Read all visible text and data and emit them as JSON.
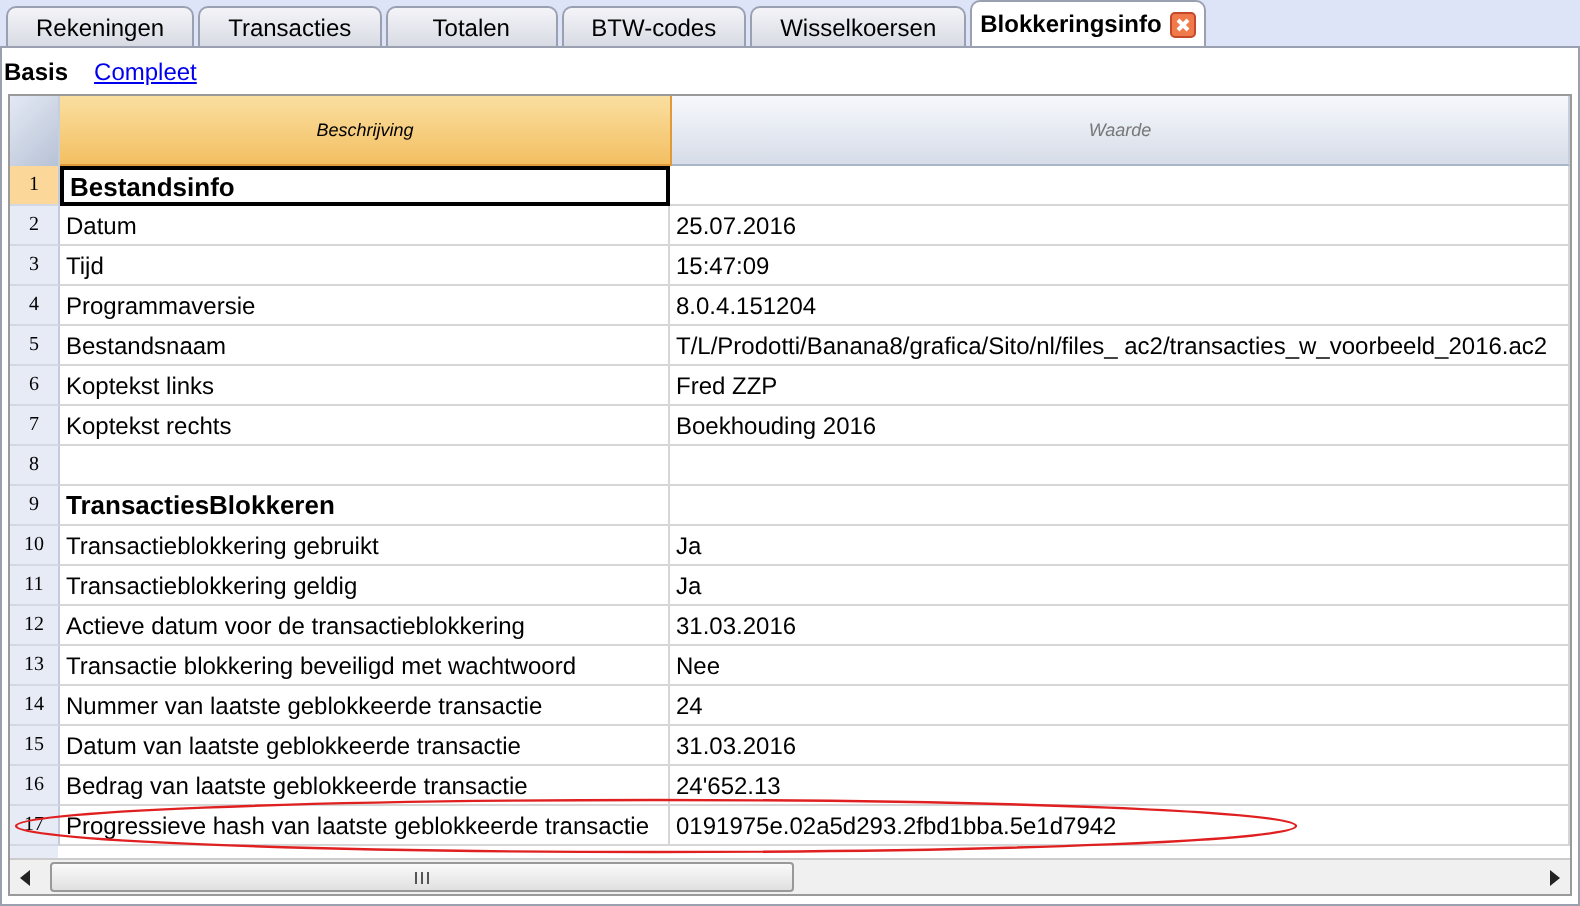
{
  "tabs": [
    {
      "label": "Rekeningen",
      "selected": false,
      "closable": false
    },
    {
      "label": "Transacties",
      "selected": false,
      "closable": false
    },
    {
      "label": "Totalen",
      "selected": false,
      "closable": false
    },
    {
      "label": "BTW-codes",
      "selected": false,
      "closable": false
    },
    {
      "label": "Wisselkoersen",
      "selected": false,
      "closable": false
    },
    {
      "label": "Blokkeringsinfo",
      "selected": true,
      "closable": true
    }
  ],
  "views": [
    {
      "label": "Basis",
      "selected": true
    },
    {
      "label": "Compleet",
      "selected": false
    }
  ],
  "table": {
    "columns": [
      {
        "label": "Beschrijving",
        "selected": true
      },
      {
        "label": "Waarde",
        "selected": false
      }
    ],
    "rows": [
      {
        "number": "1",
        "kind": "section",
        "description": "Bestandsinfo",
        "value": "",
        "selected": true,
        "circled": false
      },
      {
        "number": "2",
        "kind": "item",
        "description": "Datum",
        "value": "25.07.2016",
        "selected": false,
        "circled": false
      },
      {
        "number": "3",
        "kind": "item",
        "description": "Tijd",
        "value": "15:47:09",
        "selected": false,
        "circled": false
      },
      {
        "number": "4",
        "kind": "item",
        "description": "Programmaversie",
        "value": "8.0.4.151204",
        "selected": false,
        "circled": false
      },
      {
        "number": "5",
        "kind": "item",
        "description": "Bestandsnaam",
        "value": "T/L/Prodotti/Banana8/grafica/Sito/nl/files_ ac2/transacties_w_voorbeeld_2016.ac2",
        "selected": false,
        "circled": false
      },
      {
        "number": "6",
        "kind": "item",
        "description": "Koptekst links",
        "value": "Fred ZZP",
        "selected": false,
        "circled": false
      },
      {
        "number": "7",
        "kind": "item",
        "description": "Koptekst rechts",
        "value": "Boekhouding 2016",
        "selected": false,
        "circled": false
      },
      {
        "number": "8",
        "kind": "item",
        "description": "",
        "value": "",
        "selected": false,
        "circled": false
      },
      {
        "number": "9",
        "kind": "section",
        "description": "TransactiesBlokkeren",
        "value": "",
        "selected": false,
        "circled": false
      },
      {
        "number": "10",
        "kind": "item",
        "description": "Transactieblokkering gebruikt",
        "value": "Ja",
        "selected": false,
        "circled": false
      },
      {
        "number": "11",
        "kind": "item",
        "description": "Transactieblokkering geldig",
        "value": "Ja",
        "selected": false,
        "circled": false
      },
      {
        "number": "12",
        "kind": "item",
        "description": "Actieve datum voor de transactieblokkering",
        "value": "31.03.2016",
        "selected": false,
        "circled": false
      },
      {
        "number": "13",
        "kind": "item",
        "description": "Transactie blokkering beveiligd met wachtwoord",
        "value": "Nee",
        "selected": false,
        "circled": false
      },
      {
        "number": "14",
        "kind": "item",
        "description": "Nummer van laatste geblokkeerde transactie",
        "value": "24",
        "selected": false,
        "circled": false
      },
      {
        "number": "15",
        "kind": "item",
        "description": "Datum van laatste geblokkeerde transactie",
        "value": "31.03.2016",
        "selected": false,
        "circled": false
      },
      {
        "number": "16",
        "kind": "item",
        "description": "Bedrag van laatste geblokkeerde transactie",
        "value": "24'652.13",
        "selected": false,
        "circled": false
      },
      {
        "number": "17",
        "kind": "item",
        "description": "Progressieve hash van laatste geblokkeerde transactie",
        "value": "0191975e.02a5d293.2fbd1bba.5e1d7942",
        "selected": false,
        "circled": true
      }
    ]
  }
}
